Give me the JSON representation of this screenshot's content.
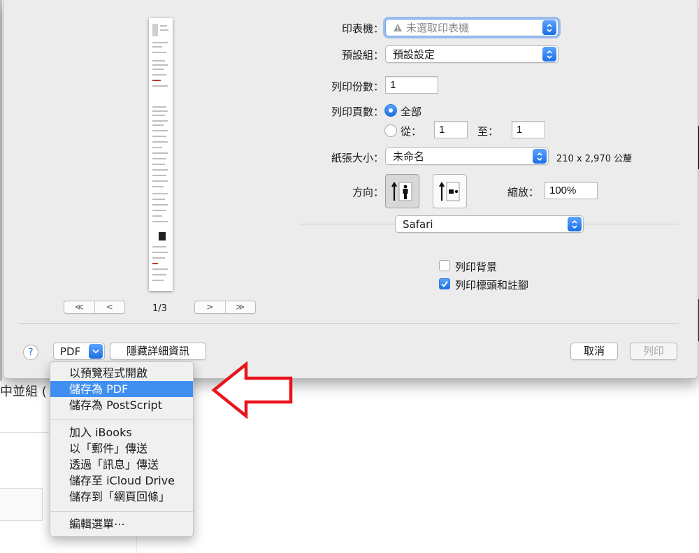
{
  "dialog": {
    "printer": {
      "label": "印表機：",
      "value": "未選取印表機",
      "warning_icon": "warning-triangle-icon"
    },
    "presets": {
      "label": "預設組：",
      "value": "預設設定"
    },
    "copies": {
      "label": "列印份數：",
      "value": "1"
    },
    "pages": {
      "label": "列印頁數：",
      "all_label": "全部",
      "from_label": "從：",
      "from_value": "1",
      "to_label": "至：",
      "to_value": "1",
      "selected": "all"
    },
    "paper_size": {
      "label": "紙張大小：",
      "value": "未命名",
      "dimensions": "210 x 2,970 公釐"
    },
    "orientation": {
      "label": "方向：",
      "selected": "portrait"
    },
    "scale": {
      "label": "縮放：",
      "value": "100%"
    },
    "section": {
      "value": "Safari"
    },
    "options": [
      {
        "label": "列印背景",
        "checked": false
      },
      {
        "label": "列印標頭和註腳",
        "checked": true
      }
    ],
    "preview": {
      "page_indicator": "1/3",
      "first_label": "≪",
      "prev_label": "<",
      "next_label": ">",
      "last_label": "≫"
    },
    "footer": {
      "help_label": "?",
      "pdf_label": "PDF",
      "hide_details_label": "隱藏詳細資訊",
      "cancel_label": "取消",
      "print_label": "列印"
    }
  },
  "pdf_menu": {
    "groups": [
      [
        "以預覽程式開啟",
        "儲存為 PDF",
        "儲存為 PostScript"
      ],
      [
        "加入 iBooks",
        "以「郵件」傳送",
        "透過「訊息」傳送",
        "儲存至 iCloud Drive",
        "儲存到「網頁回條」"
      ],
      [
        "編輯選單⋯"
      ]
    ],
    "highlighted": "儲存為 PDF"
  },
  "background": {
    "peek_text": "中並組 ("
  },
  "colors": {
    "accent": "#3f8ef0",
    "annotation_arrow": "#e8141b",
    "dialog_bg": "#ececec"
  }
}
